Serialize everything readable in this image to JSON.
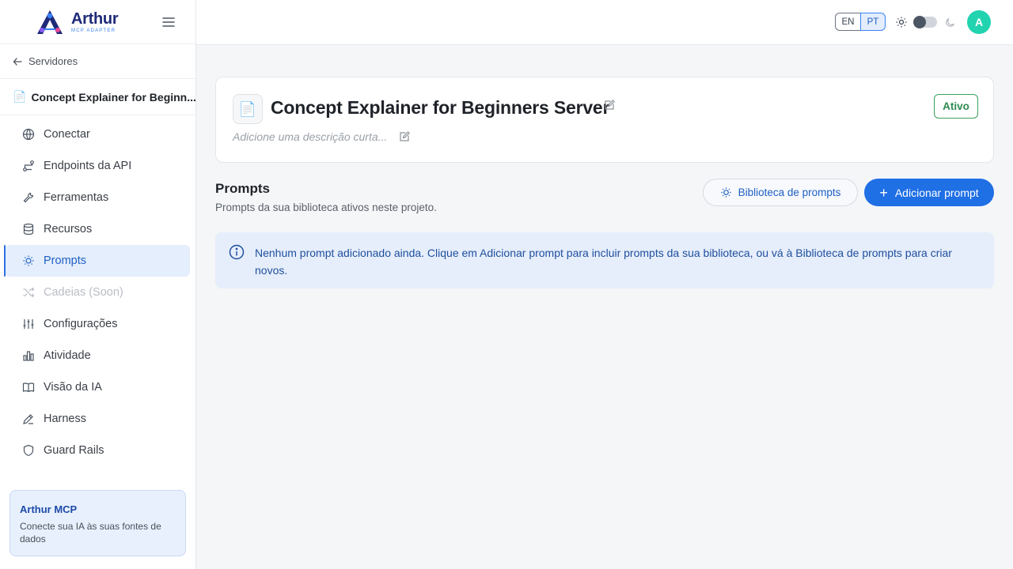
{
  "brand": {
    "name": "Arthur",
    "subtitle": "MCP ADAPTER"
  },
  "sidebar": {
    "back_label": "Servidores",
    "project_name": "Concept Explainer for Beginn...",
    "items": [
      {
        "label": "Conectar",
        "icon": "globe-icon"
      },
      {
        "label": "Endpoints da API",
        "icon": "route-icon"
      },
      {
        "label": "Ferramentas",
        "icon": "wrench-icon"
      },
      {
        "label": "Recursos",
        "icon": "database-icon"
      },
      {
        "label": "Prompts",
        "icon": "lightbulb-icon",
        "active": true
      },
      {
        "label": "Cadeias (Soon)",
        "icon": "shuffle-icon",
        "disabled": true
      },
      {
        "label": "Configurações",
        "icon": "sliders-icon"
      },
      {
        "label": "Atividade",
        "icon": "bar-chart-icon"
      },
      {
        "label": "Visão da IA",
        "icon": "book-icon"
      },
      {
        "label": "Harness",
        "icon": "pen-icon"
      },
      {
        "label": "Guard Rails",
        "icon": "shield-icon"
      }
    ],
    "promo": {
      "title": "Arthur MCP",
      "description": "Conecte sua IA às suas fontes de dados"
    }
  },
  "topbar": {
    "lang_en": "EN",
    "lang_pt": "PT",
    "selected_lang": "PT",
    "theme_dark": false,
    "avatar_initial": "A"
  },
  "server": {
    "title": "Concept Explainer for Beginners Server",
    "description_placeholder": "Adicione uma descrição curta...",
    "status": "Ativo"
  },
  "prompts": {
    "title": "Prompts",
    "subtitle": "Prompts da sua biblioteca ativos neste projeto.",
    "library_button": "Biblioteca de prompts",
    "add_button": "Adicionar prompt",
    "empty_message": "Nenhum prompt adicionado ainda. Clique em Adicionar prompt para incluir prompts da sua biblioteca, ou vá à Biblioteca de prompts para criar novos."
  },
  "colors": {
    "accent": "#1f6fe5",
    "active_bg": "#e4eefc",
    "status_green": "#2e8b4e",
    "avatar": "#22d3b0"
  }
}
